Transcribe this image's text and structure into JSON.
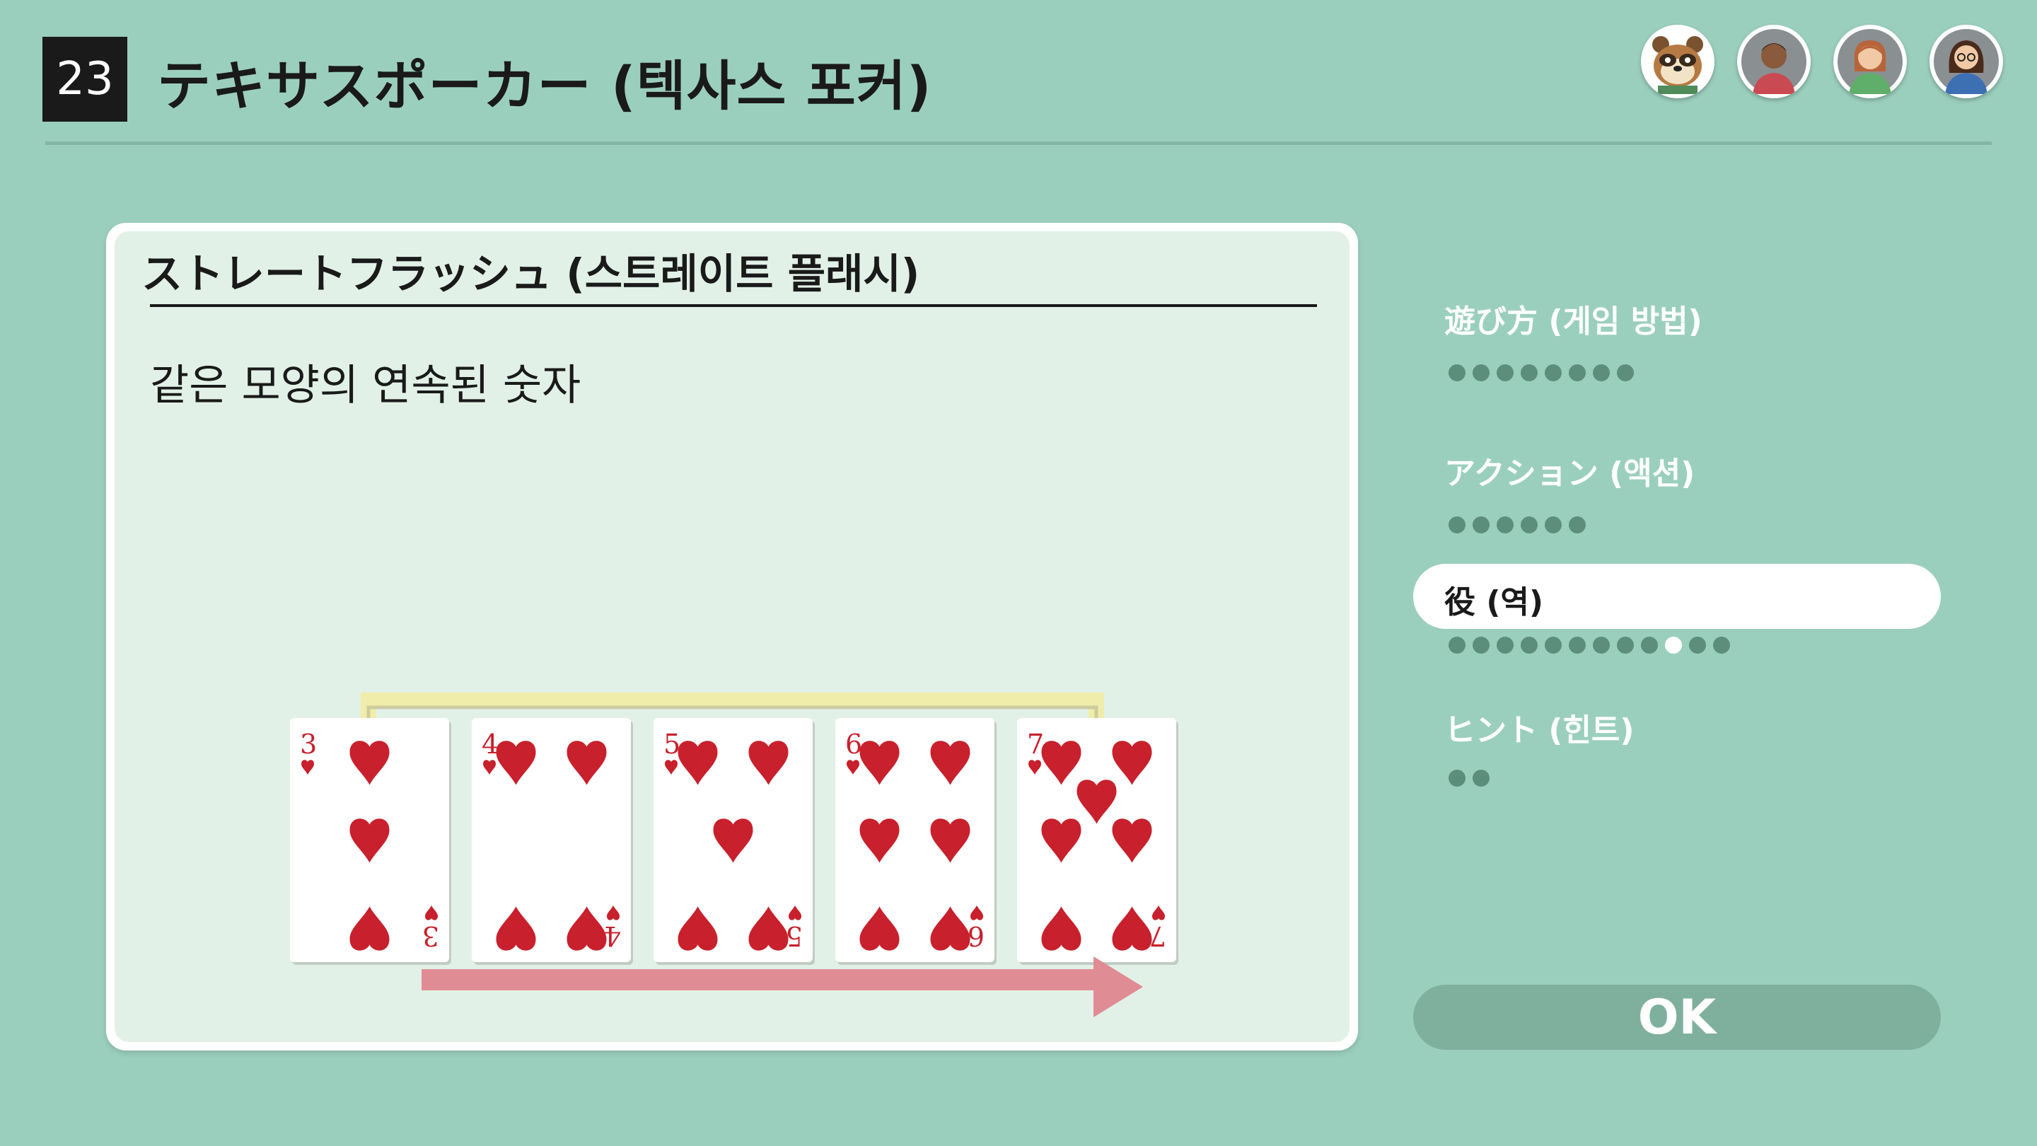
{
  "header": {
    "game_number": "23",
    "title": "テキサスポーカー (텍사스 포커)"
  },
  "players": [
    {
      "name": "tanuki-avatar"
    },
    {
      "name": "player-avatar-2"
    },
    {
      "name": "player-avatar-3"
    },
    {
      "name": "player-avatar-4"
    }
  ],
  "panel": {
    "title": "ストレートフラッシュ (스트레이트 플래시)",
    "description": "같은 모양의 연속된 숫자",
    "cards": [
      {
        "rank": "3",
        "suit": "heart"
      },
      {
        "rank": "4",
        "suit": "heart"
      },
      {
        "rank": "5",
        "suit": "heart"
      },
      {
        "rank": "6",
        "suit": "heart"
      },
      {
        "rank": "7",
        "suit": "heart"
      }
    ]
  },
  "menu": {
    "items": [
      {
        "label": "遊び方 (게임 방법)",
        "dots": 8,
        "active_dot": -1,
        "selected": false
      },
      {
        "label": "アクション (액션)",
        "dots": 6,
        "active_dot": -1,
        "selected": false
      },
      {
        "label": "役 (역)",
        "dots": 12,
        "active_dot": 9,
        "selected": true
      },
      {
        "label": "ヒント (힌트)",
        "dots": 2,
        "active_dot": -1,
        "selected": false
      }
    ]
  },
  "ok_button": {
    "label": "OK"
  },
  "colors": {
    "background": "#9bcfbd",
    "panel": "#e2f1e7",
    "heart": "#c8202c",
    "suit_bracket": "#f0ecaa",
    "sequence_arrow": "#e08c94"
  }
}
